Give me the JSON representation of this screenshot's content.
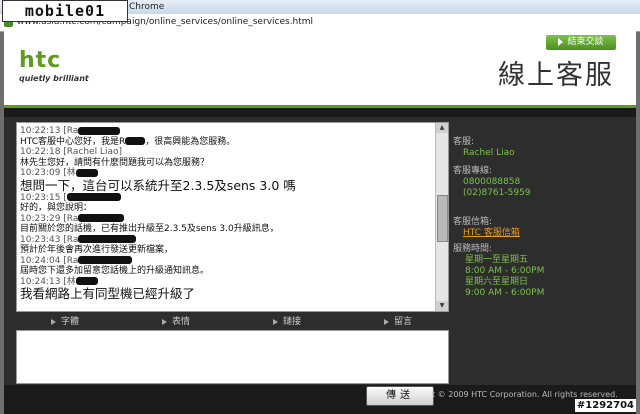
{
  "browser": {
    "title": "Chrome",
    "url": "www.asia.htc.com/campaign/online_services/online_services.html"
  },
  "watermark": {
    "logo": "mobile01",
    "id": "#1292704"
  },
  "header": {
    "brand": "htc",
    "tagline": "quietly brilliant",
    "title": "線上客服",
    "end_button": "結束交談"
  },
  "chat": {
    "messages": [
      {
        "time": "10:22:13",
        "sender": "[Ra",
        "text": "HTC客服中心您好，我是R",
        "text2": "，很高興能為您服務。",
        "big": false
      },
      {
        "time": "10:22:18",
        "sender": "[Rachel Liao]",
        "text": "林先生您好，請問有什麼問題我可以為您服務？",
        "big": false
      },
      {
        "time": "10:23:09",
        "sender": "[林",
        "text": "想問一下，這台可以系統升至2.3.5及sens 3.0 嗎",
        "big": true
      },
      {
        "time": "10:23:15",
        "sender": "[",
        "text": "好的，與您說明：",
        "big": false
      },
      {
        "time": "10:23:29",
        "sender": "[Ra",
        "text": "目前關於您的話機，已有推出升級至2.3.5及sens 3.0升級訊息，",
        "big": false
      },
      {
        "time": "10:23:43",
        "sender": "[Ra",
        "text": "預計於年後會再次進行發送更新檔案，",
        "big": false
      },
      {
        "time": "10:24:04",
        "sender": "[Ra",
        "text": "屆時您下還多加留意您話機上的升級通知訊息。",
        "big": false
      },
      {
        "time": "10:24:13",
        "sender": "[林",
        "text": "我看網路上有同型機已經升級了",
        "big": true
      }
    ]
  },
  "toolbar": {
    "font": "字體",
    "emoticon": "表情",
    "link": "鏈接",
    "message": "留言"
  },
  "sidebar": {
    "agent_label": "客服:",
    "agent_name": "Rachel Liao",
    "hotline_label": "客服專線:",
    "hotline1": "0800088858",
    "hotline2": "(02)8761-5959",
    "mail_label": "客服信箱:",
    "mail_link": "HTC 客服信箱",
    "hours_label": "服務時間:",
    "hours": [
      "星期一至星期五",
      "8:00 AM - 6:00PM",
      "星期六至星期日",
      "9:00 AM - 6:00PM"
    ]
  },
  "footer": {
    "copyright": "t © 2009 HTC Corporation. All rights reserved.",
    "send": "傳送"
  },
  "colors": {
    "accent": "#5e9b1e",
    "link": "#e89a1a",
    "panel": "#2d2d2d"
  }
}
